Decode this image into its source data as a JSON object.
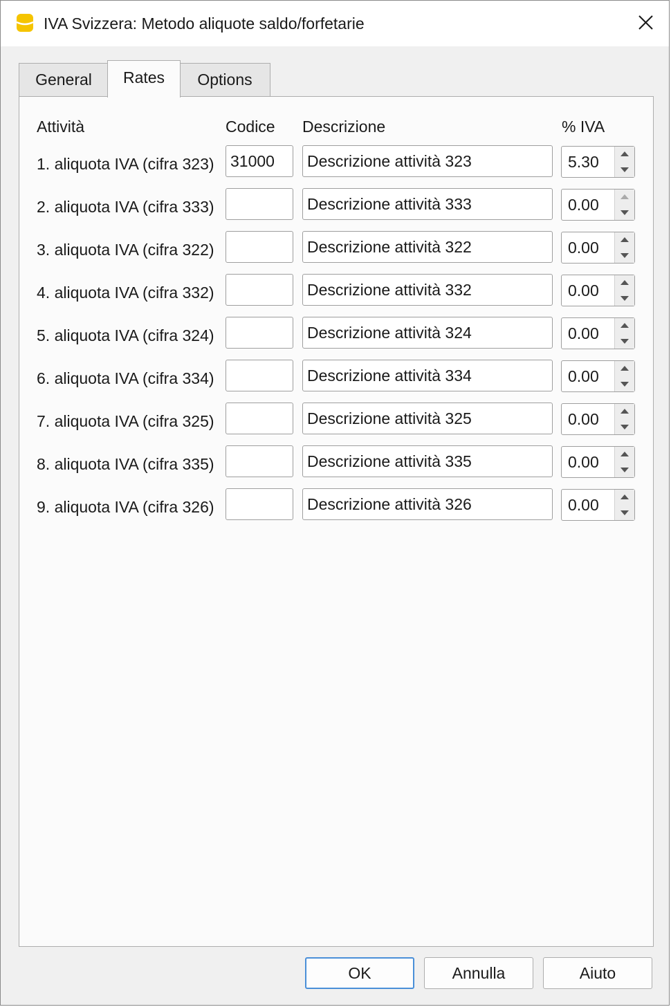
{
  "window": {
    "title": "IVA Svizzera: Metodo aliquote saldo/forfetarie",
    "icon": "app-database-icon",
    "accent_color": "#f5c400"
  },
  "tabs": [
    {
      "label": "General",
      "active": false
    },
    {
      "label": "Rates",
      "active": true
    },
    {
      "label": "Options",
      "active": false
    }
  ],
  "headers": {
    "activity": "Attività",
    "code": "Codice",
    "description": "Descrizione",
    "vat_percent": "% IVA"
  },
  "rows": [
    {
      "label": "1. aliquota IVA (cifra 323)",
      "code": "31000",
      "description": "Descrizione attività 323",
      "vat": "5.30"
    },
    {
      "label": "2. aliquota IVA (cifra 333)",
      "code": "",
      "description": "Descrizione attività 333",
      "vat": "0.00"
    },
    {
      "label": "3. aliquota IVA (cifra 322)",
      "code": "",
      "description": "Descrizione attività 322",
      "vat": "0.00"
    },
    {
      "label": "4. aliquota IVA (cifra 332)",
      "code": "",
      "description": "Descrizione attività 332",
      "vat": "0.00"
    },
    {
      "label": "5. aliquota IVA (cifra 324)",
      "code": "",
      "description": "Descrizione attività 324",
      "vat": "0.00"
    },
    {
      "label": "6. aliquota IVA (cifra 334)",
      "code": "",
      "description": "Descrizione attività 334",
      "vat": "0.00"
    },
    {
      "label": "7. aliquota IVA (cifra 325)",
      "code": "",
      "description": "Descrizione attività 325",
      "vat": "0.00"
    },
    {
      "label": "8. aliquota IVA (cifra 335)",
      "code": "",
      "description": "Descrizione attività 335",
      "vat": "0.00"
    },
    {
      "label": "9. aliquota IVA (cifra 326)",
      "code": "",
      "description": "Descrizione attività 326",
      "vat": "0.00"
    }
  ],
  "buttons": {
    "ok": "OK",
    "cancel": "Annulla",
    "help": "Aiuto"
  }
}
